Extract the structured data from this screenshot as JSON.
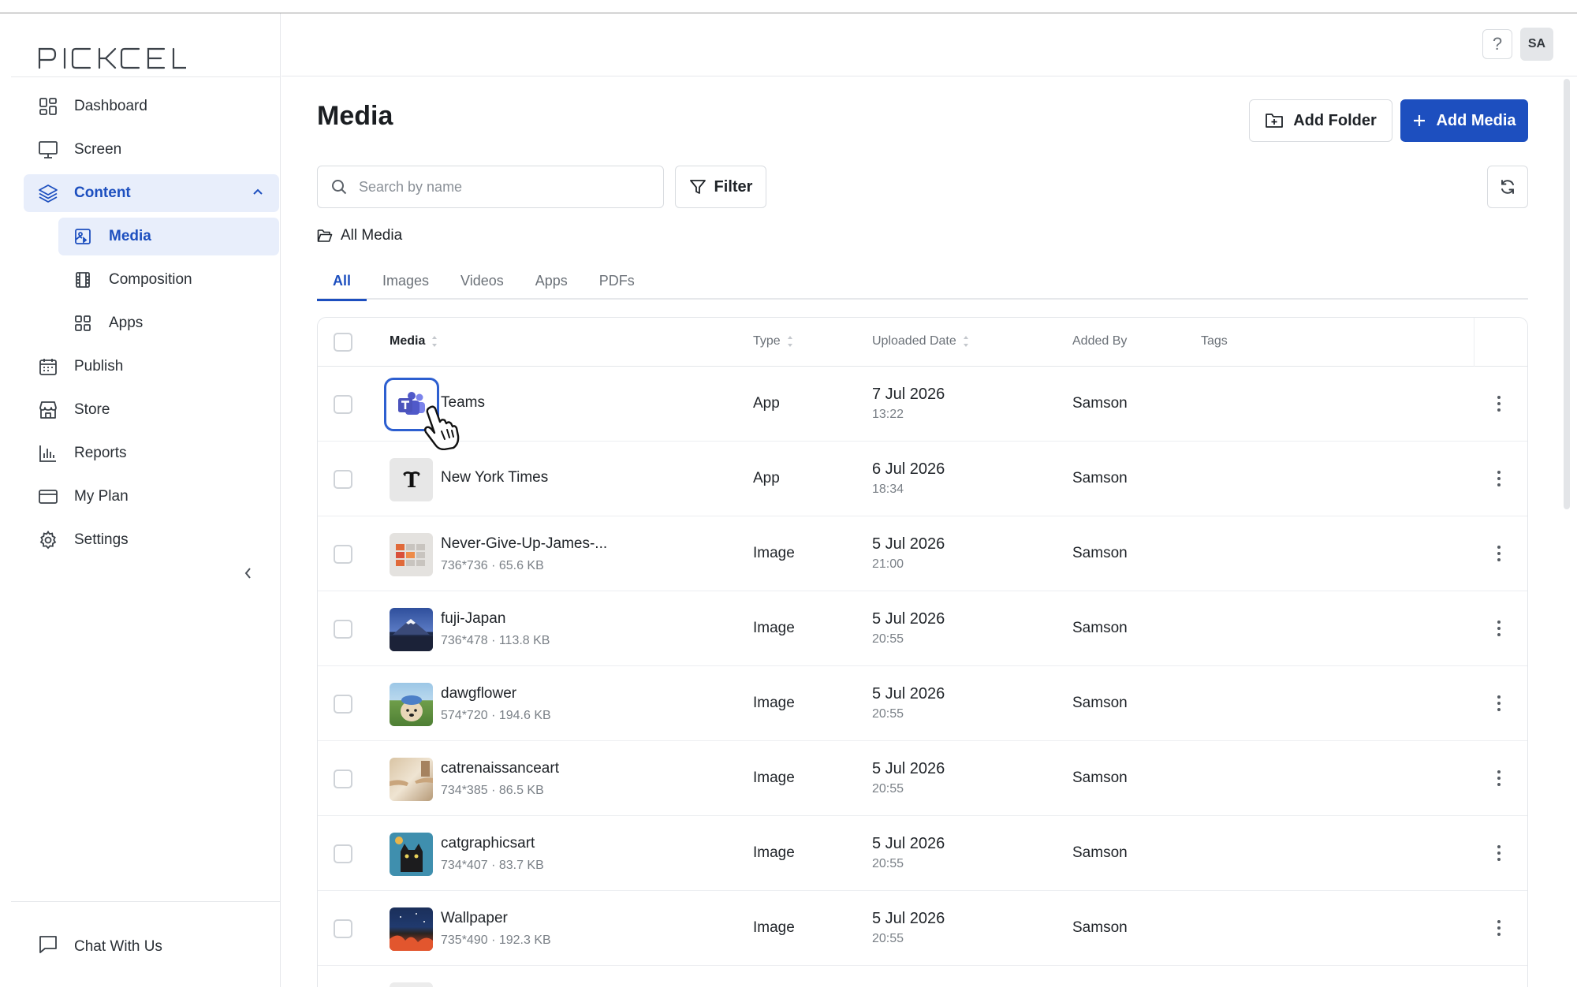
{
  "app": {
    "logo": "PICKCEL"
  },
  "sidebar": {
    "items": [
      {
        "label": "Dashboard",
        "icon": "dashboard-icon"
      },
      {
        "label": "Screen",
        "icon": "monitor-icon"
      },
      {
        "label": "Content",
        "icon": "layers-icon",
        "active": true,
        "expanded": true
      },
      {
        "label": "Media",
        "icon": "media-icon",
        "sub": true,
        "active": true
      },
      {
        "label": "Composition",
        "icon": "film-icon",
        "sub": true
      },
      {
        "label": "Apps",
        "icon": "apps-icon",
        "sub": true
      },
      {
        "label": "Publish",
        "icon": "calendar-icon"
      },
      {
        "label": "Store",
        "icon": "store-icon"
      },
      {
        "label": "Reports",
        "icon": "bar-chart-icon"
      },
      {
        "label": "My Plan",
        "icon": "card-icon"
      },
      {
        "label": "Settings",
        "icon": "gear-icon"
      }
    ],
    "chat_label": "Chat With Us"
  },
  "header": {
    "help": "?",
    "avatar": "SA"
  },
  "main": {
    "title": "Media",
    "add_folder": "Add Folder",
    "add_media": "Add Media",
    "search_placeholder": "Search by name",
    "filter": "Filter",
    "breadcrumb": "All Media",
    "tabs": [
      "All",
      "Images",
      "Videos",
      "Apps",
      "PDFs"
    ],
    "active_tab": "All",
    "columns": {
      "media": "Media",
      "type": "Type",
      "uploaded": "Uploaded Date",
      "added_by": "Added By",
      "tags": "Tags"
    },
    "rows": [
      {
        "name": "Teams",
        "meta": "",
        "type": "App",
        "date": "7 Jul 2026",
        "time": "13:22",
        "added_by": "Samson"
      },
      {
        "name": "New York Times",
        "meta": "",
        "type": "App",
        "date": "6 Jul 2026",
        "time": "18:34",
        "added_by": "Samson"
      },
      {
        "name": "Never-Give-Up-James-...",
        "meta": "736*736 · 65.6 KB",
        "type": "Image",
        "date": "5 Jul 2026",
        "time": "21:00",
        "added_by": "Samson"
      },
      {
        "name": "fuji-Japan",
        "meta": "736*478 · 113.8 KB",
        "type": "Image",
        "date": "5 Jul 2026",
        "time": "20:55",
        "added_by": "Samson"
      },
      {
        "name": "dawgflower",
        "meta": "574*720 · 194.6 KB",
        "type": "Image",
        "date": "5 Jul 2026",
        "time": "20:55",
        "added_by": "Samson"
      },
      {
        "name": "catrenaissanceart",
        "meta": "734*385 · 86.5 KB",
        "type": "Image",
        "date": "5 Jul 2026",
        "time": "20:55",
        "added_by": "Samson"
      },
      {
        "name": "catgraphicsart",
        "meta": "734*407 · 83.7 KB",
        "type": "Image",
        "date": "5 Jul 2026",
        "time": "20:55",
        "added_by": "Samson"
      },
      {
        "name": "Wallpaper",
        "meta": "735*490 · 192.3 KB",
        "type": "Image",
        "date": "5 Jul 2026",
        "time": "20:55",
        "added_by": "Samson"
      }
    ]
  },
  "colors": {
    "accent": "#1d4fbf",
    "active_bg": "#e8eefb"
  }
}
